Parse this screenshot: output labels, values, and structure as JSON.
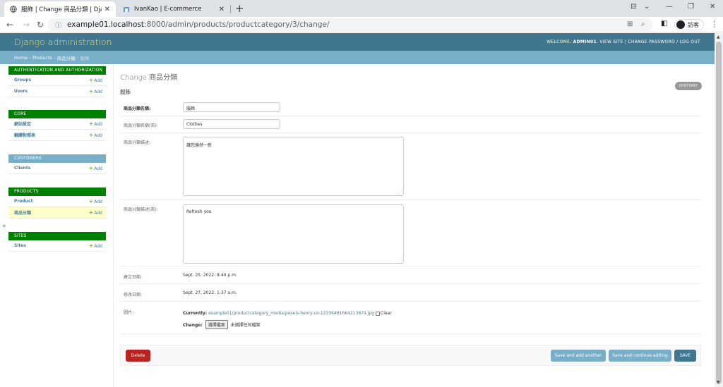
{
  "browser": {
    "tabs": [
      {
        "title": "服飾 | Change 商品分類 | Djang",
        "favicon": "globe-icon",
        "active": true
      },
      {
        "title": "IvanKao | E-commerce",
        "favicon": "shop-icon",
        "active": false
      }
    ],
    "url_host": "example01.localhost",
    "url_path": ":8000/admin/products/productcategory/3/change/",
    "guest_label": "訪客"
  },
  "header": {
    "brand": "Django administration",
    "welcome": "WELCOME,",
    "user": "ADMIN01",
    "view_site": "VIEW SITE",
    "change_password": "CHANGE PASSWORD",
    "log_out": "LOG OUT"
  },
  "breadcrumb": {
    "home": "Home",
    "app": "Products",
    "model": "商品分類",
    "current": "服飾"
  },
  "sidebar": {
    "modules": [
      {
        "caption": "AUTHENTICATION AND AUTHORIZATION",
        "rows": [
          {
            "name": "Groups",
            "add": "Add"
          },
          {
            "name": "Users",
            "add": "Add"
          }
        ]
      },
      {
        "caption": "CORE",
        "rows": [
          {
            "name": "網站設定",
            "add": "Add"
          },
          {
            "name": "翻譯對照表",
            "add": "Add"
          }
        ]
      },
      {
        "caption": "CUSTOMERS",
        "rows": [
          {
            "name": "Clients",
            "add": "Add"
          }
        ]
      },
      {
        "caption": "PRODUCTS",
        "rows": [
          {
            "name": "Product",
            "add": "Add"
          },
          {
            "name": "商品分類",
            "add": "Add"
          }
        ]
      },
      {
        "caption": "SITES",
        "rows": [
          {
            "name": "Sites",
            "add": "Add"
          }
        ]
      }
    ],
    "collapse": "«"
  },
  "main": {
    "title": "Change 商品分類",
    "object_name": "服飾",
    "history": "HISTORY",
    "fields": {
      "name_label": "商品分類名稱:",
      "name_value": "服飾",
      "name_en_label": "商品分類名稱(英):",
      "name_en_value": "Clothes",
      "desc_label": "商品分類描述:",
      "desc_value": "讓您煥然一新",
      "desc_en_label": "商品分類描述(英):",
      "desc_en_value": "Refresh you",
      "created_label": "建立日期:",
      "created_value": "Sept. 25, 2022, 8:40 p.m.",
      "modified_label": "修改日期:",
      "modified_value": "Sept. 27, 2022, 1:37 a.m.",
      "image_label": "圖片:",
      "currently_label": "Currently:",
      "currently_link": "example01/productcategory_media/pexels-henry-co-1233648166421387​9.jpg",
      "clear_label": "Clear",
      "change_label": "Change:",
      "choose_file": "選擇檔案",
      "no_file": "未選擇任何檔案"
    },
    "buttons": {
      "delete": "Delete",
      "save_add": "Save and add another",
      "save_continue": "Save and continue editing",
      "save": "SAVE"
    }
  }
}
